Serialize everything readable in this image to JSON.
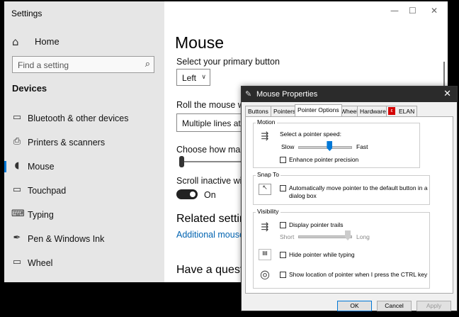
{
  "settings": {
    "title": "Settings",
    "win_min": "—",
    "win_max": "☐",
    "win_close": "✕",
    "home": "Home",
    "search_placeholder": "Find a setting",
    "section": "Devices",
    "nav": [
      {
        "label": "Bluetooth & other devices",
        "icon": "bluetooth-icon",
        "glyph": "▭"
      },
      {
        "label": "Printers & scanners",
        "icon": "printer-icon",
        "glyph": "⎙"
      },
      {
        "label": "Mouse",
        "icon": "mouse-icon",
        "glyph": "◖",
        "selected": true
      },
      {
        "label": "Touchpad",
        "icon": "touchpad-icon",
        "glyph": "▭"
      },
      {
        "label": "Typing",
        "icon": "keyboard-icon",
        "glyph": "⌨"
      },
      {
        "label": "Pen & Windows Ink",
        "icon": "pen-icon",
        "glyph": "✒"
      },
      {
        "label": "Wheel",
        "icon": "wheel-icon",
        "glyph": "▭"
      }
    ],
    "page_title": "Mouse",
    "primary_button_label": "Select your primary button",
    "primary_button_value": "Left",
    "roll_label": "Roll the mouse whe",
    "roll_value": "Multiple lines at a",
    "lines_label": "Choose how many l",
    "inactive_label": "Scroll inactive windo",
    "toggle_state": "On",
    "related": "Related setting",
    "additional_link": "Additional mouse o",
    "question": "Have a questio"
  },
  "dialog": {
    "title": "Mouse Properties",
    "tabs": [
      "Buttons",
      "Pointers",
      "Pointer Options",
      "Wheel",
      "Hardware",
      "ELAN"
    ],
    "active_tab": "Pointer Options",
    "motion": {
      "label": "Motion",
      "speed_label": "Select a pointer speed:",
      "slow": "Slow",
      "fast": "Fast",
      "speed_value": 0.6,
      "precision": "Enhance pointer precision"
    },
    "snap": {
      "label": "Snap To",
      "text_line1": "Automatically move pointer to the default button in a",
      "text_line2": "dialog box"
    },
    "visibility": {
      "label": "Visibility",
      "trails": "Display pointer trails",
      "short": "Short",
      "long": "Long",
      "hide": "Hide pointer while typing",
      "show": "Show location of pointer when I press the CTRL key"
    },
    "buttons": {
      "ok": "OK",
      "cancel": "Cancel",
      "apply": "Apply"
    }
  }
}
